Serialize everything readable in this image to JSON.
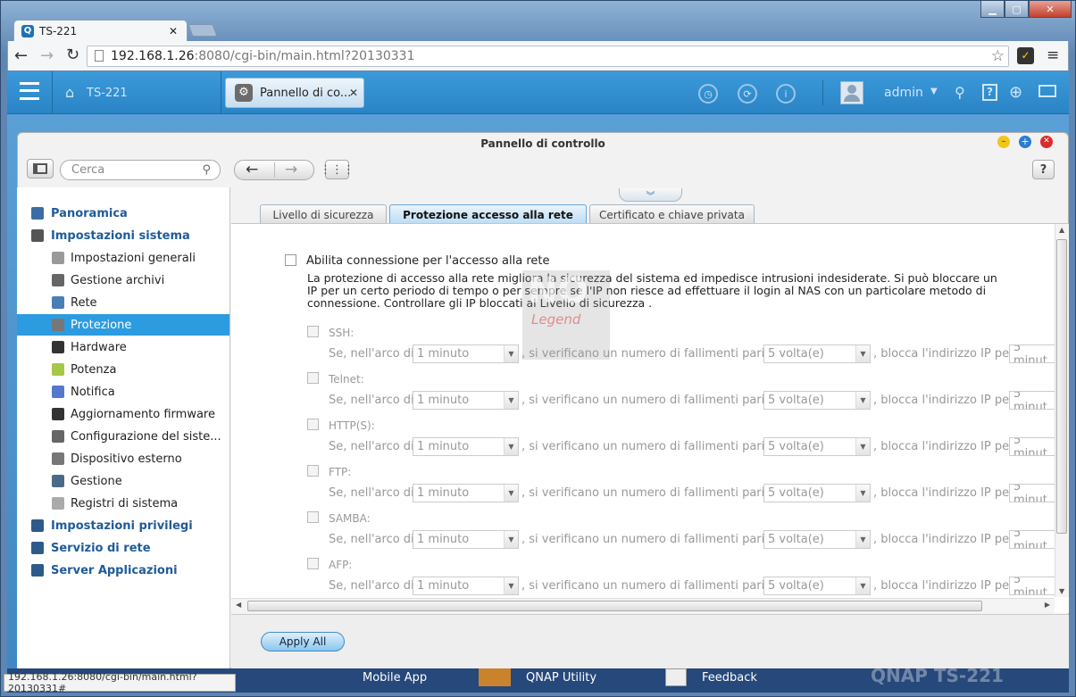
{
  "browser": {
    "tab_title": "TS-221",
    "url_host": "192.168.1.26",
    "url_rest": ":8080/cgi-bin/main.html?20130331",
    "status_url": "192.168.1.26:8080/cgi-bin/main.html?20130331#"
  },
  "qnap": {
    "home_label": "TS-221",
    "open_app": "Pannello di co...",
    "user": "admin"
  },
  "panel": {
    "title": "Pannello di controllo",
    "search_placeholder": "Cerca",
    "help": "?"
  },
  "sidebar": {
    "items": [
      {
        "label": "Panoramica",
        "level": "top"
      },
      {
        "label": "Impostazioni sistema",
        "level": "top"
      },
      {
        "label": "Impostazioni generali",
        "level": "sub"
      },
      {
        "label": "Gestione archivi",
        "level": "sub"
      },
      {
        "label": "Rete",
        "level": "sub"
      },
      {
        "label": "Protezione",
        "level": "sub",
        "selected": true
      },
      {
        "label": "Hardware",
        "level": "sub"
      },
      {
        "label": "Potenza",
        "level": "sub"
      },
      {
        "label": "Notifica",
        "level": "sub"
      },
      {
        "label": "Aggiornamento firmware",
        "level": "sub"
      },
      {
        "label": "Configurazione del siste...",
        "level": "sub"
      },
      {
        "label": "Dispositivo esterno",
        "level": "sub"
      },
      {
        "label": "Gestione",
        "level": "sub"
      },
      {
        "label": "Registri di sistema",
        "level": "sub"
      },
      {
        "label": "Impostazioni privilegi",
        "level": "top"
      },
      {
        "label": "Servizio di rete",
        "level": "top"
      },
      {
        "label": "Server Applicazioni",
        "level": "top"
      }
    ]
  },
  "tabs": [
    "Livello di sicurezza",
    "Protezione accesso alla rete",
    "Certificato e chiave privata"
  ],
  "content": {
    "enable_label": "Abilita connessione per l'accesso alla rete",
    "description_1": "La protezione di accesso alla rete migliora la sicurezza del sistema ed impedisce intrusioni indesiderate. Si può bloccare un",
    "description_2": "IP per un certo periodo di tempo o per sempre se l'IP non riesce ad effettuare il login al NAS con un particolare metodo di",
    "description_3": "connessione. Controllare gli IP bloccati al Livello di sicurezza .",
    "rule_prefix": "Se, nell'arco di",
    "rule_mid": ", si verificano un numero di fallimenti pari a",
    "rule_suffix": ", blocca l'indirizzo IP per",
    "time_value": "1 minuto",
    "count_value": "5 volta(e)",
    "block_value": "5 minut",
    "protocols": [
      "SSH:",
      "Telnet:",
      "HTTP(S):",
      "FTP:",
      "SAMBA:",
      "AFP:"
    ]
  },
  "watermark": {
    "line1": "NO",
    "line2": "Legend"
  },
  "footer": {
    "apply": "Apply All"
  },
  "taskbar": {
    "items": [
      "Mobile App",
      "QNAP Utility",
      "Feedback"
    ],
    "brand": "QNAP  TS-221"
  }
}
